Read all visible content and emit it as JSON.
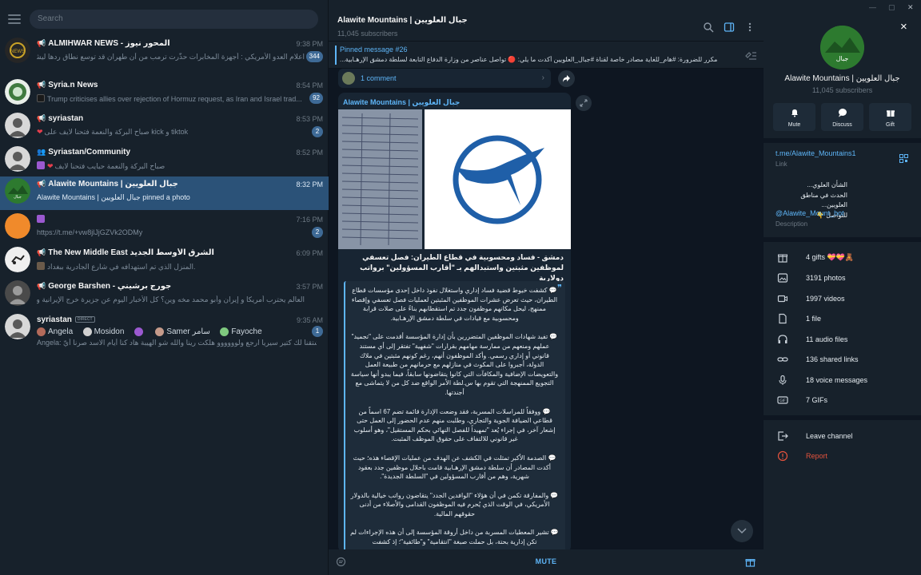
{
  "search": {
    "placeholder": "Search"
  },
  "chats": [
    {
      "title": "ALMIHWAR NEWS - المحور نيوز",
      "kind": "channel",
      "time": "9:38 PM",
      "preview": "اعلام العدو الأمريكي : أجهزة المخابرات حذّرت ترمب من أن طهران قد توسع نطاق ردها ليشمل خلفاء ...",
      "badge": "344",
      "avatar": "#2b2b2b"
    },
    {
      "title": "Syria.n News",
      "kind": "channel",
      "time": "8:54 PM",
      "preview": "Trump criticises allies over rejection of Hormuz request, as Iran and Israel trad...",
      "badge": "92",
      "avatar": "#3f7a3f"
    },
    {
      "title": "syriastan",
      "kind": "channel",
      "time": "8:53 PM",
      "preview": "صباح البركة والنعمة فتحنا لايف على kick و tiktok",
      "badge": "2",
      "avatar": "#c8c8c8"
    },
    {
      "title": "Syriastan/Community",
      "kind": "group",
      "time": "8:52 PM",
      "preview": "صباح البركة والنعمة حبايب فتحنا لايف",
      "badge": "",
      "avatar": "#c8c8c8"
    },
    {
      "title": "Alawite Mountains | جبال العلويين",
      "kind": "channel",
      "time": "8:32 PM",
      "preview": "Alawite Mountains | جبال العلويين pinned a photo",
      "badge": "",
      "avatar": "#2d7a2f"
    },
    {
      "title": "",
      "kind": "",
      "time": "7:16 PM",
      "preview": "https://t.me/+vw8jlJjGZVk2ODMy",
      "badge": "2",
      "avatar": "#f08a2b"
    },
    {
      "title": "The New Middle East الشرق الأوسط الجديد",
      "kind": "channel",
      "time": "6:09 PM",
      "preview": "المنزل الذي تم استهدافه في شارع الجادرية ببغداد.",
      "badge": "",
      "avatar": "#e8e8e8"
    },
    {
      "title": "George Barshen - جورج برشيني",
      "kind": "channel",
      "time": "3:57 PM",
      "preview": "العالم يحترب أمريكا و إيران وأبو محمد مخه وين؟ كل الأخبار اليوم عن جزيرة خرج الإيرانية والجولاني حافظ ع...",
      "badge": "",
      "avatar": "#555555"
    },
    {
      "title": "syriastan",
      "kind": "",
      "time": "9:35 AM",
      "preview": "Angela: اشتقنا لك كتير سيريا ارجع ولوووووو هلكت رينا والله شو الهيبة هاد كنا أيام الاسد صرنا أيّ",
      "badge": "1",
      "avatar": "#c8c8c8"
    }
  ],
  "story_chips": [
    "Angela",
    "Mosidon",
    "",
    "Samer سامر",
    "Fayoche"
  ],
  "direct_label": "DIRECT",
  "channel": {
    "title": "Alawite Mountains | جبال العلويين",
    "subscribers": "11,045 subscribers",
    "pinned_title": "Pinned message #26",
    "pinned_text": "مكرر للضرورة: #هام_للغاية   مصادر خاصة لقناة #جبال_العلويين أكدت ما يلي: 🔴 تواصل عناصر من وزارة الدفاع التابعة لسلطة دمشق الإرهـابية...",
    "comments": "1 comment",
    "author": "Alawite Mountains | جبال العلويين",
    "headline": "دمشق - فساد ومحسوبية في قطاع الطيران: فصل تعسفي لموظفين مثبتين واستبدالهم بـ \"أقارب المسؤولين\" برواتب دولارية",
    "paragraphs": [
      "💬 كشفت خيوط قضية فساد إداري واستغلال نفوذ داخل إحدى مؤسسات قطاع الطيران، حيث تعرض عشرات الموظفين المثبتين لعمليات فصل تعسفي وإقصاء ممنهج، ليحل مكانهم موظفون جدد تم استقطابهم بناءً على صلات قرابة ومحسوبية مع قيادات في سلطة دمشق الإرهـابية.",
      "💬 تفيد شهادات الموظفين المتضررين بأن إدارة المؤسسة أقدمت على \"تجميد\" عملهم ومنعهم من ممارسة مهامهم بقرارات \"شفهية\" تفتقر إلى أي مستند قانوني أو إداري رسمي. وأكد الموظفون أنهم، رغم كونهم مثبتين في ملاك الدولة، أجبروا على المكوث في منازلهم مع حرمانهم من طبيعة العمل والتعويضات الإضافية والمكافآت التي كانوا يتقاضونها سابقاً، فيما يبدو أنها سياسة التجويع الممنهجة التي تقوم بها س.لطة الأمر الواقع ضد كل من لا يتماشى مع أجندتها.",
      "💬 ووفقاً للمراسلات المسربة، فقد وضعت الإدارة قائمة تضم 67 اسماً من قطاعي الضيافة الجوية والتجاري، وطلبت منهم عدم الحضور إلى العمل حتى إشعار آخر، في إجراء يُعد \"تمهيداً للفصل النهائي بحكم المستقيل\"، وهو أسلوب غير قانوني للالتفاف على حقوق الموظف المثبت.",
      "💬 الصدمة الأكبر تمثلت في الكشف عن الهدف من عمليات الإقصاء هذه؛ حيث أكدت المصادر أن سلطة دمشق الإرهـابية قامت باحلال موظفين جدد بعقود شهرية، وهم من أقارب المسؤولين في \"السلطة الجديدة\".",
      "💬 والمفارقة تكمن في أن هؤلاء \"الوافدين الجدد\" يتقاضون رواتب خيالية بالدولار الأمريكي، في الوقت الذي يُحرم فيه الموظفون القدامى والأصلاء من أدنى حقوقهم المالية.",
      "💬 تشير المعطيات المسربة من داخل أروقة المؤسسة إلى أن هذه الإجراءات لم تكن إدارية بحتة، بل حملت صبغة \"انتقامية\" و\"طائفية\"؛ إذ كشفت"
    ],
    "mute_label": "MUTE"
  },
  "info": {
    "name": "Alawite Mountains | جبال العلويين",
    "subscribers": "11,045 subscribers",
    "actions": [
      {
        "label": "Mute",
        "icon": "bell-icon"
      },
      {
        "label": "Discuss",
        "icon": "chat-bubble-icon"
      },
      {
        "label": "Gift",
        "icon": "gift-icon"
      }
    ],
    "link": "t.me/Alawite_Mountains1",
    "link_label": "Link",
    "description_lines": [
      "الشأن العلوي...",
      "الحدث في مناطق العلويين...",
      "للتواصل 👇"
    ],
    "description_link": "@Alawite_Mount_bot",
    "description_label": "Description",
    "media": [
      {
        "label": "4 gifts 💝💝🧸",
        "icon": "gift-icon"
      },
      {
        "label": "3191 photos",
        "icon": "photo-icon"
      },
      {
        "label": "1997 videos",
        "icon": "video-icon"
      },
      {
        "label": "1 file",
        "icon": "file-icon"
      },
      {
        "label": "11 audio files",
        "icon": "headphones-icon"
      },
      {
        "label": "136 shared links",
        "icon": "link-icon"
      },
      {
        "label": "18 voice messages",
        "icon": "microphone-icon"
      },
      {
        "label": "7 GIFs",
        "icon": "gif-icon"
      }
    ],
    "leave_label": "Leave channel",
    "report_label": "Report"
  },
  "colors": {
    "accent": "#5eb5f7",
    "active_row": "#2b5278",
    "report": "#e5533d",
    "badge": "#3e6a96"
  }
}
